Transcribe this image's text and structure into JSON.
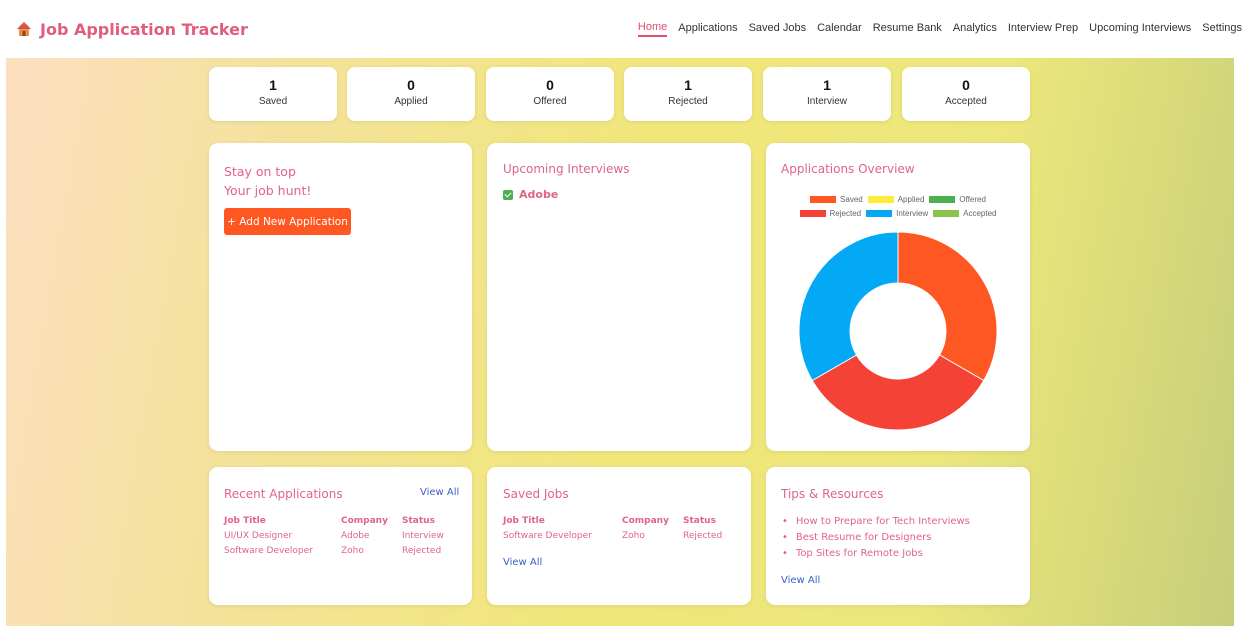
{
  "app": {
    "title": "Job Application Tracker"
  },
  "nav": {
    "items": [
      {
        "label": "Home",
        "active": true
      },
      {
        "label": "Applications"
      },
      {
        "label": "Saved Jobs"
      },
      {
        "label": "Calendar"
      },
      {
        "label": "Resume Bank"
      },
      {
        "label": "Analytics"
      },
      {
        "label": "Interview Prep"
      },
      {
        "label": "Upcoming Interviews"
      },
      {
        "label": "Settings"
      }
    ]
  },
  "stats": [
    {
      "value": "1",
      "label": "Saved"
    },
    {
      "value": "0",
      "label": "Applied"
    },
    {
      "value": "0",
      "label": "Offered"
    },
    {
      "value": "1",
      "label": "Rejected"
    },
    {
      "value": "1",
      "label": "Interview"
    },
    {
      "value": "0",
      "label": "Accepted"
    }
  ],
  "hero": {
    "line1": "Stay on top",
    "line2": "Your job hunt!",
    "button": "+ Add New Application"
  },
  "upcoming": {
    "title": "Upcoming Interviews",
    "items": [
      {
        "company": "Adobe"
      }
    ]
  },
  "overview": {
    "title": "Applications Overview"
  },
  "chart_data": {
    "type": "pie",
    "categories": [
      "Saved",
      "Applied",
      "Offered",
      "Rejected",
      "Interview",
      "Accepted"
    ],
    "values": [
      1,
      0,
      0,
      1,
      1,
      0
    ],
    "colors": [
      "#ff5722",
      "#ffeb3b",
      "#4caf50",
      "#f44336",
      "#03a9f4",
      "#8bc34a"
    ],
    "legend": "top"
  },
  "recent": {
    "title": "Recent Applications",
    "view_all": "View All",
    "headers": [
      "Job Title",
      "Company",
      "Status"
    ],
    "rows": [
      [
        "UI/UX Designer",
        "Adobe",
        "Interview"
      ],
      [
        "Software Developer",
        "Zoho",
        "Rejected"
      ]
    ]
  },
  "saved": {
    "title": "Saved Jobs",
    "view_all": "View All",
    "headers": [
      "Job Title",
      "Company",
      "Status"
    ],
    "rows": [
      [
        "Software Developer",
        "Zoho",
        "Rejected"
      ]
    ]
  },
  "tips": {
    "title": "Tips & Resources",
    "view_all": "View All",
    "items": [
      "How to Prepare for Tech Interviews",
      "Best Resume for Designers",
      "Top Sites for Remote Jobs"
    ]
  }
}
